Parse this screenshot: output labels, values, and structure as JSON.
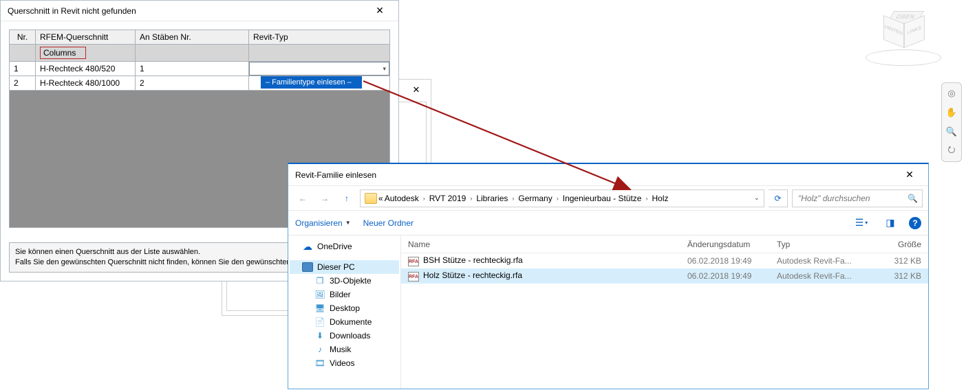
{
  "dlg1": {
    "title": "Querschnitt in Revit nicht gefunden",
    "columns": {
      "nr": "Nr.",
      "rfem": "RFEM-Querschnitt",
      "stab": "An Stäben Nr.",
      "revit": "Revit-Typ"
    },
    "group_label": "Columns",
    "rows": [
      {
        "nr": "1",
        "rfem": "H-Rechteck 480/520",
        "stab": "1",
        "revit": ""
      },
      {
        "nr": "2",
        "rfem": "H-Rechteck 480/1000",
        "stab": "2",
        "revit": ""
      }
    ],
    "dropdown_option": "– Familientype einlesen –",
    "help1": "Sie können einen Querschnitt aus der Liste auswählen.",
    "help2": "Falls Sie den gewünschten Querschnitt nicht finden, können Sie den gewünschten Typ einlesen."
  },
  "dlg2": {
    "title": "Revit-Familie einlesen",
    "breadcrumbs": {
      "pre": "«",
      "parts": [
        "Autodesk",
        "RVT 2019",
        "Libraries",
        "Germany",
        "Ingenieurbau - Stütze",
        "Holz"
      ]
    },
    "search_placeholder": "\"Holz\" durchsuchen",
    "tools": {
      "organize": "Organisieren",
      "newfolder": "Neuer Ordner"
    },
    "tree": {
      "onedrive": "OneDrive",
      "thispc": "Dieser PC",
      "items": [
        "3D-Objekte",
        "Bilder",
        "Desktop",
        "Dokumente",
        "Downloads",
        "Musik",
        "Videos"
      ]
    },
    "file_headers": {
      "name": "Name",
      "date": "Änderungsdatum",
      "type": "Typ",
      "size": "Größe"
    },
    "files": [
      {
        "name": "BSH Stütze - rechteckig.rfa",
        "date": "06.02.2018 19:49",
        "type": "Autodesk Revit-Fa...",
        "size": "312 KB",
        "selected": false
      },
      {
        "name": "Holz Stütze - rechteckig.rfa",
        "date": "06.02.2018 19:49",
        "type": "Autodesk Revit-Fa...",
        "size": "312 KB",
        "selected": true
      }
    ]
  },
  "viewcube": {
    "top": "OBEN",
    "left": "HINTEN",
    "right": "LINKS"
  }
}
